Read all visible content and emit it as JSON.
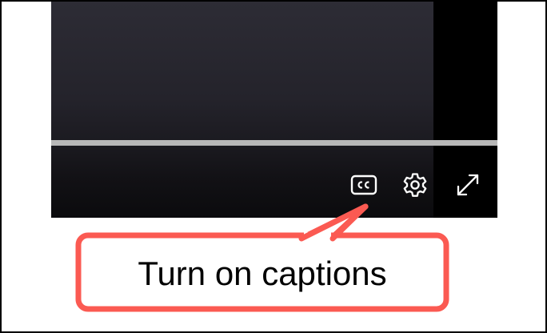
{
  "player": {
    "progress_fraction": 0.0,
    "controls": {
      "captions_icon": "closed-captions-icon",
      "settings_icon": "gear-icon",
      "fullscreen_icon": "expand-arrows-icon"
    }
  },
  "callout": {
    "text": "Turn on captions",
    "border_color": "#fb5a52"
  }
}
